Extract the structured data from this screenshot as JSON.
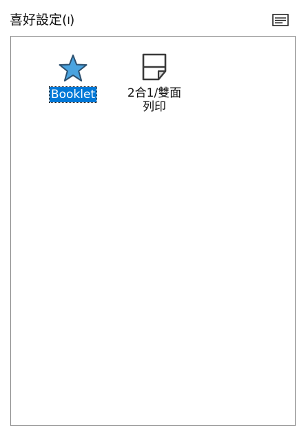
{
  "header": {
    "title": "喜好設定(",
    "accelerator": "I",
    "title_suffix": ")",
    "menu_icon": "menu-icon"
  },
  "presets": [
    {
      "label": "Booklet",
      "icon": "star-icon",
      "selected": true
    },
    {
      "label": "2合1/雙面\n列印",
      "icon": "page-fold-icon",
      "selected": false
    }
  ],
  "colors": {
    "selection": "#0078d7",
    "star_fill": "#4aa3df",
    "star_stroke": "#2b4f6e"
  }
}
